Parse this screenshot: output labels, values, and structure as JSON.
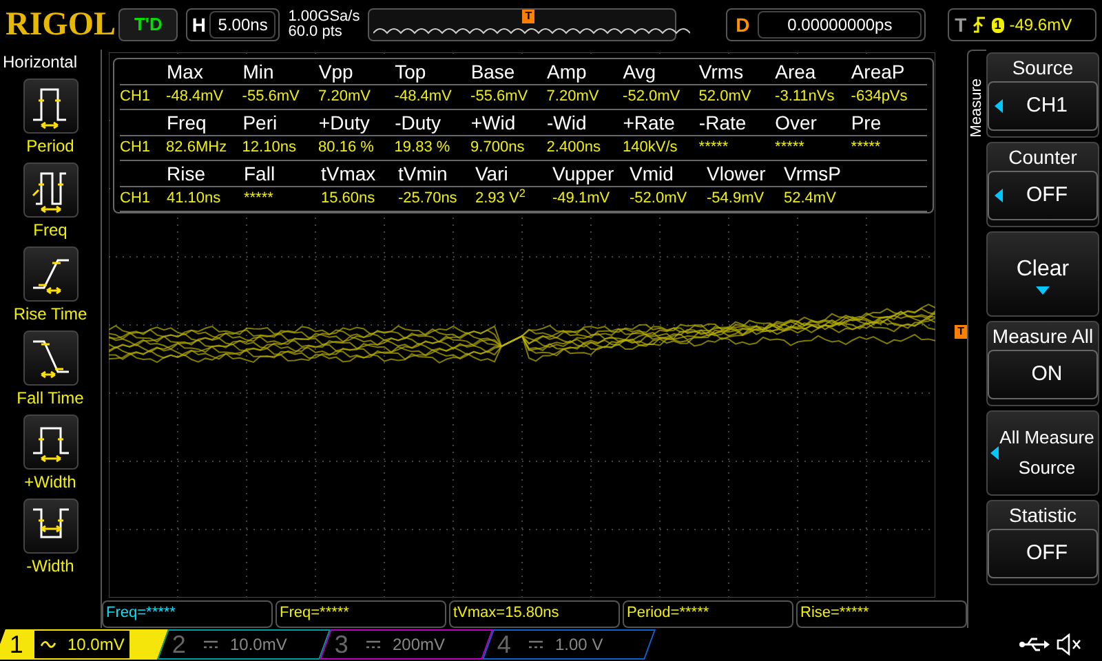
{
  "header": {
    "logo": "RIGOL",
    "run_status": "T'D",
    "horizontal": {
      "label": "H",
      "value": "5.00ns"
    },
    "sample_rate": "1.00GSa/s",
    "memory": "60.0 pts",
    "delay": {
      "label": "D",
      "value": "0.00000000ps"
    },
    "trigger": {
      "label": "T",
      "source": "1",
      "level": "-49.6mV"
    }
  },
  "sidebar": {
    "title": "Horizontal",
    "items": [
      {
        "label": "Period",
        "kind": "period",
        "selected": false
      },
      {
        "label": "Freq",
        "kind": "freq",
        "selected": false
      },
      {
        "label": "Rise Time",
        "kind": "rise",
        "selected": false
      },
      {
        "label": "Fall Time",
        "kind": "fall",
        "selected": false
      },
      {
        "label": "+Width",
        "kind": "pwidth",
        "selected": false
      },
      {
        "label": "-Width",
        "kind": "nwidth",
        "selected": false
      }
    ]
  },
  "markers": {
    "trigger_position": "T",
    "trigger_level": "T"
  },
  "measure_table": {
    "groups": [
      {
        "headers": [
          "Max",
          "Min",
          "Vpp",
          "Top",
          "Base",
          "Amp",
          "Avg",
          "Vrms",
          "Area",
          "AreaP"
        ],
        "channel": "CH1",
        "values": [
          "-48.4mV",
          "-55.6mV",
          "7.20mV",
          "-48.4mV",
          "-55.6mV",
          "7.20mV",
          "-52.0mV",
          "52.0mV",
          "-3.11nVs",
          "-634pVs"
        ]
      },
      {
        "headers": [
          "Freq",
          "Peri",
          "+Duty",
          "-Duty",
          "+Wid",
          "-Wid",
          "+Rate",
          "-Rate",
          "Over",
          "Pre"
        ],
        "channel": "CH1",
        "values": [
          "82.6MHz",
          "12.10ns",
          "80.16 %",
          "19.83 %",
          "9.700ns",
          "2.400ns",
          "140kV/s",
          "*****",
          "*****",
          "*****"
        ]
      },
      {
        "headers": [
          "Rise",
          "Fall",
          "tVmax",
          "tVmin",
          "Vari",
          "Vupper",
          "Vmid",
          "Vlower",
          "VrmsP"
        ],
        "channel": "CH1",
        "values": [
          "41.10ns",
          "*****",
          "15.60ns",
          "-25.70ns",
          {
            "text": "2.93 V",
            "sup": "2"
          },
          "-49.1mV",
          "-52.0mV",
          "-54.9mV",
          "52.4mV"
        ]
      }
    ]
  },
  "menu": {
    "tab": "Measure",
    "items": [
      {
        "kind": "select",
        "title": "Source",
        "value": "CH1"
      },
      {
        "kind": "select",
        "title": "Counter",
        "value": "OFF"
      },
      {
        "kind": "action",
        "title": "Clear"
      },
      {
        "kind": "toggle",
        "title": "Measure All",
        "value": "ON"
      },
      {
        "kind": "submenu",
        "title": "All Measure Source"
      },
      {
        "kind": "toggle",
        "title": "Statistic",
        "value": "OFF"
      }
    ]
  },
  "results": [
    {
      "text": "Freq=*****",
      "color": "#00e5ff"
    },
    {
      "text": "Freq=*****",
      "color": "#f0f000"
    },
    {
      "text": "tVmax=15.80ns",
      "color": "#f0f000"
    },
    {
      "text": "Period=*****",
      "color": "#f0f000"
    },
    {
      "text": "Rise=*****",
      "color": "#f0f000"
    }
  ],
  "channels": [
    {
      "number": "1",
      "kind": "ac",
      "scale": "10.0mV",
      "selected": true,
      "color": "#f5e50a"
    },
    {
      "number": "2",
      "kind": "dc",
      "scale": "10.0mV",
      "selected": false,
      "color": "#00a0a0"
    },
    {
      "number": "3",
      "kind": "dc",
      "scale": "200mV",
      "selected": false,
      "color": "#c000c0"
    },
    {
      "number": "4",
      "kind": "dc",
      "scale": "1.00 V",
      "selected": false,
      "color": "#1060d0"
    }
  ]
}
